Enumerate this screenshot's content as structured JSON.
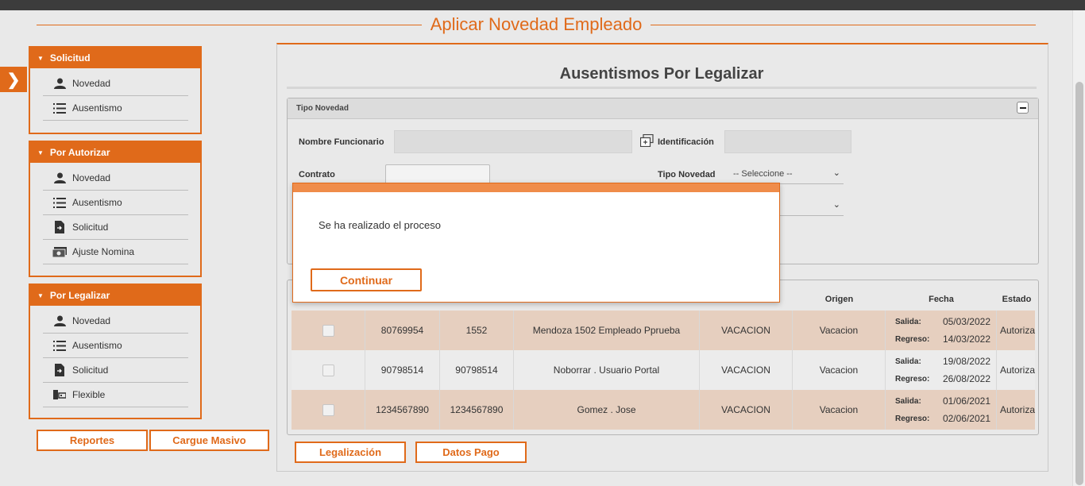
{
  "page": {
    "title": "Aplicar Novedad Empleado"
  },
  "sidebar": {
    "panels": [
      {
        "title": "Solicitud",
        "items": [
          {
            "label": "Novedad",
            "icon": "user-icon"
          },
          {
            "label": "Ausentismo",
            "icon": "list-icon"
          }
        ]
      },
      {
        "title": "Por Autorizar",
        "items": [
          {
            "label": "Novedad",
            "icon": "user-icon"
          },
          {
            "label": "Ausentismo",
            "icon": "list-icon"
          },
          {
            "label": "Solicitud",
            "icon": "document-icon"
          },
          {
            "label": "Ajuste Nomina",
            "icon": "money-icon"
          }
        ]
      },
      {
        "title": "Por Legalizar",
        "items": [
          {
            "label": "Novedad",
            "icon": "user-icon"
          },
          {
            "label": "Ausentismo",
            "icon": "list-icon"
          },
          {
            "label": "Solicitud",
            "icon": "document-icon"
          },
          {
            "label": "Flexible",
            "icon": "door-icon"
          }
        ]
      }
    ],
    "reportes_label": "Reportes",
    "cargue_label": "Cargue Masivo"
  },
  "main": {
    "title": "Ausentismos Por Legalizar",
    "filter": {
      "header": "Tipo Novedad",
      "nombre_label": "Nombre Funcionario",
      "identificacion_label": "Identificación",
      "contrato_label": "Contrato",
      "tipo_novedad_label": "Tipo Novedad",
      "tipo_novedad_value": "-- Seleccione --"
    },
    "table": {
      "headers": {
        "origen": "Origen",
        "fecha": "Fecha",
        "estado": "Estado"
      },
      "salida_label": "Salida:",
      "regreso_label": "Regreso:",
      "rows": [
        {
          "id": "80769954",
          "code": "1552",
          "name": "Mendoza 1502 Empleado Pprueba",
          "tipo": "VACACION",
          "origen": "Vacacion",
          "salida": "05/03/2022",
          "regreso": "14/03/2022",
          "estado": "Autoriza"
        },
        {
          "id": "90798514",
          "code": "90798514",
          "name": "Noborrar . Usuario Portal",
          "tipo": "VACACION",
          "origen": "Vacacion",
          "salida": "19/08/2022",
          "regreso": "26/08/2022",
          "estado": "Autoriza"
        },
        {
          "id": "1234567890",
          "code": "1234567890",
          "name": "Gomez . Jose",
          "tipo": "VACACION",
          "origen": "Vacacion",
          "salida": "01/06/2021",
          "regreso": "02/06/2021",
          "estado": "Autoriza"
        }
      ]
    },
    "legalizacion_label": "Legalización",
    "datos_pago_label": "Datos Pago"
  },
  "modal": {
    "message": "Se ha realizado el proceso",
    "button_label": "Continuar"
  },
  "colors": {
    "accent": "#e06a1a",
    "row_highlight": "#e6cfbf",
    "modal_bar": "#ef8c4a"
  }
}
